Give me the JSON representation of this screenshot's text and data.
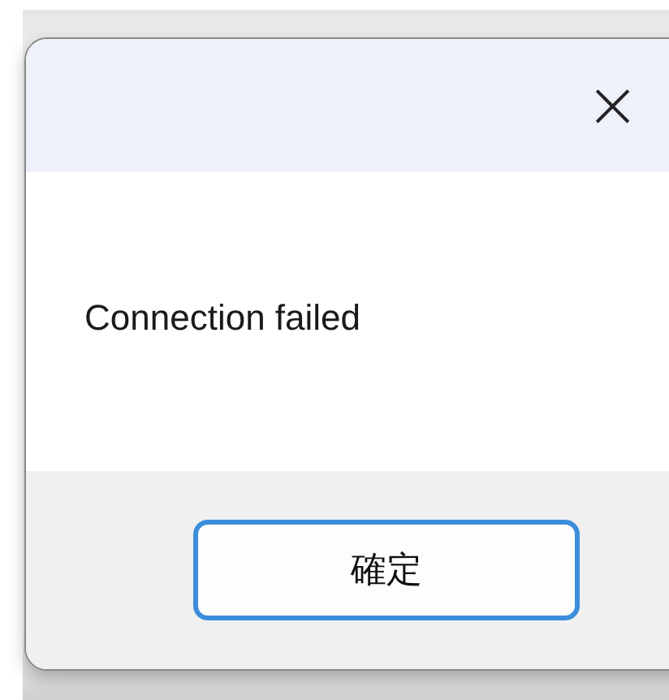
{
  "dialog": {
    "close_label": "×",
    "message": "Connection failed",
    "buttons": [
      {
        "label": "確定",
        "selected": true
      }
    ]
  }
}
